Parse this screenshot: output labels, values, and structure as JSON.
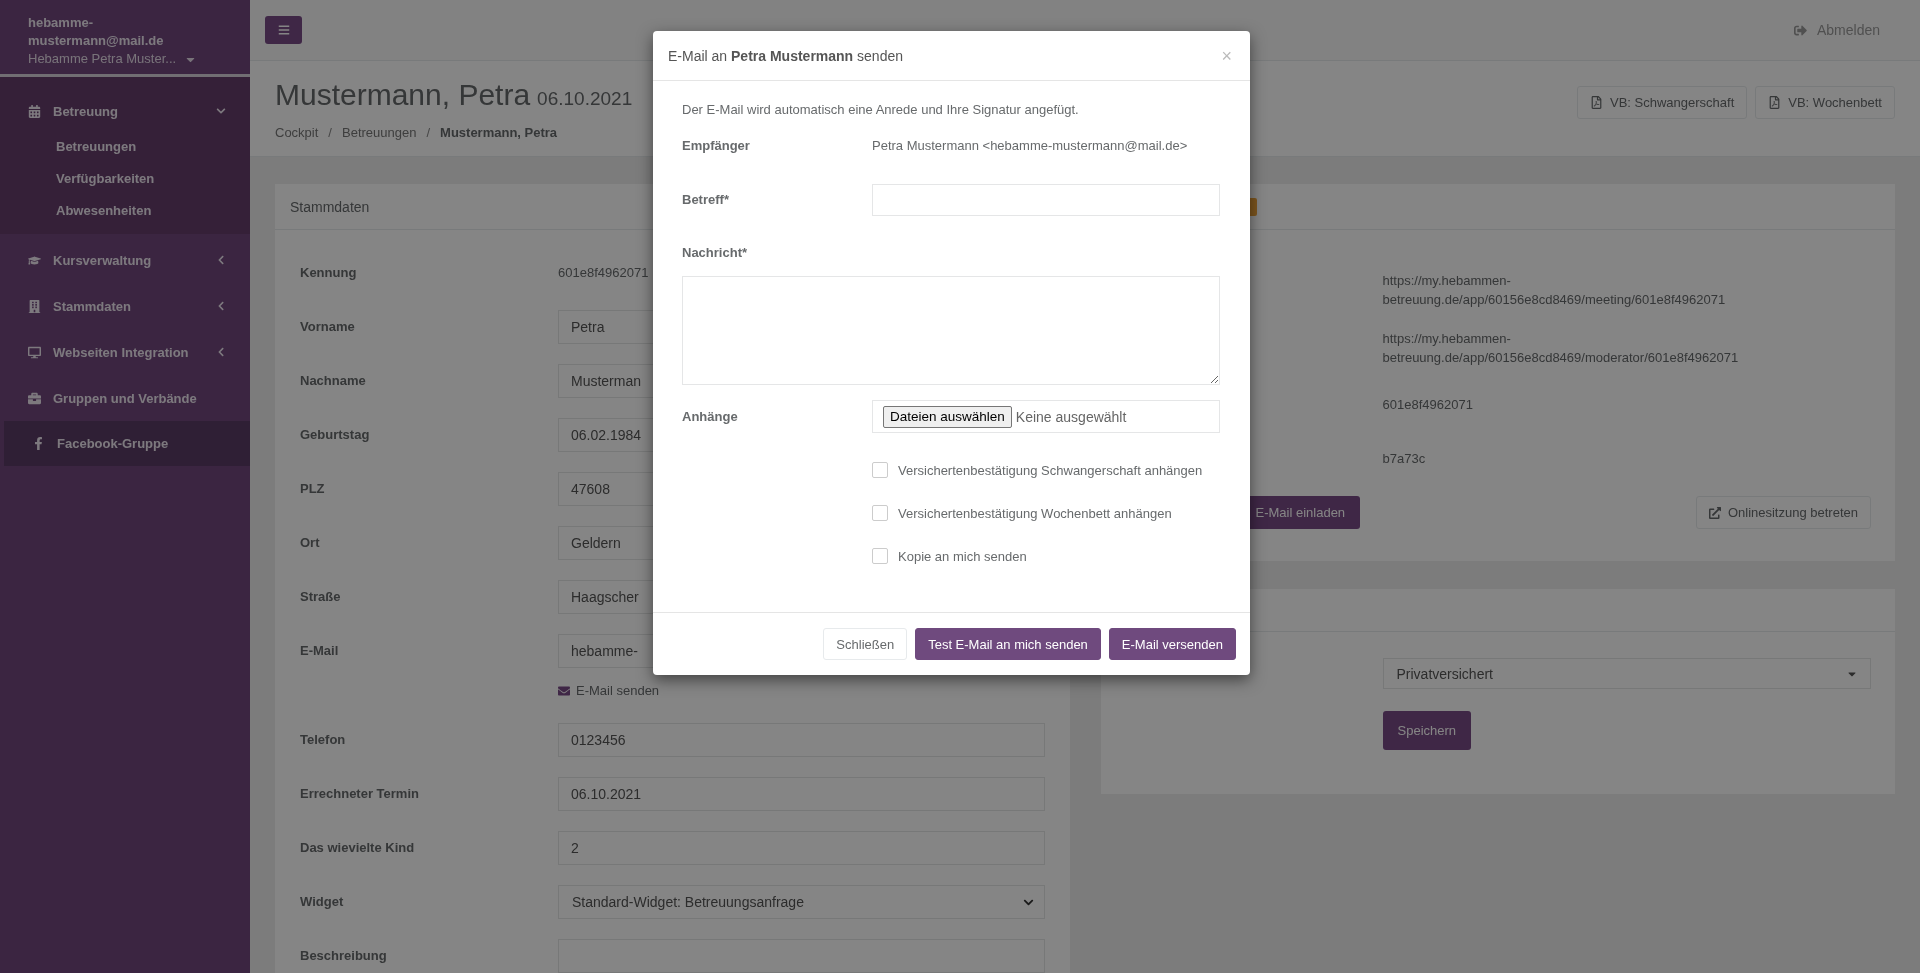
{
  "sidebar": {
    "user_email": "hebamme-mustermann@mail.de",
    "user_name": "Hebamme Petra Muster...",
    "items": [
      {
        "label": "Betreuung",
        "kind": "menu",
        "selected": false,
        "expanded": true,
        "children": [
          {
            "label": "Betreuungen"
          },
          {
            "label": "Verfügbarkeiten"
          },
          {
            "label": "Abwesenheiten"
          }
        ]
      },
      {
        "label": "Kursverwaltung",
        "kind": "menu",
        "selected": false,
        "expanded": false
      },
      {
        "label": "Stammdaten",
        "kind": "menu",
        "selected": false,
        "expanded": false
      },
      {
        "label": "Webseiten Integration",
        "kind": "menu",
        "selected": false,
        "expanded": false
      },
      {
        "label": "Gruppen und Verbände",
        "kind": "plain",
        "selected": false
      },
      {
        "label": "Facebook-Gruppe",
        "kind": "plain",
        "selected": true
      }
    ]
  },
  "topbar": {
    "logout": "Abmelden"
  },
  "page_header": {
    "title": "Mustermann, Petra",
    "date": "06.10.2021",
    "separator": "/",
    "breadcrumbs": [
      {
        "label": "Cockpit",
        "active": false
      },
      {
        "label": "Betreuungen",
        "active": false
      },
      {
        "label": "Mustermann, Petra",
        "active": true
      }
    ],
    "actions": [
      "VB: Schwangerschaft",
      "VB: Wochenbett"
    ]
  },
  "stammdaten": {
    "title": "Stammdaten",
    "fields": [
      {
        "label": "Kennung",
        "kind": "text",
        "value": "601e8f4962071"
      },
      {
        "label": "Vorname",
        "kind": "input",
        "value": "Petra"
      },
      {
        "label": "Nachname",
        "kind": "input",
        "value": "Musterman"
      },
      {
        "label": "Geburtstag",
        "kind": "input",
        "value": "06.02.1984"
      },
      {
        "label": "PLZ",
        "kind": "input",
        "value": "47608"
      },
      {
        "label": "Ort",
        "kind": "input",
        "value": "Geldern"
      },
      {
        "label": "Straße",
        "kind": "input",
        "value": "Haagscher"
      },
      {
        "label": "E-Mail",
        "kind": "input",
        "value": "hebamme-",
        "link": "E-Mail senden"
      },
      {
        "label": "Telefon",
        "kind": "input",
        "value": "0123456"
      },
      {
        "label": "Errechneter Termin",
        "kind": "input",
        "value": "06.10.2021"
      },
      {
        "label": "Das wievielte Kind",
        "kind": "input",
        "value": "2"
      },
      {
        "label": "Widget",
        "kind": "select",
        "value": "Standard-Widget: Betreuungsanfrage"
      },
      {
        "label": "Beschreibung",
        "kind": "input"
      }
    ]
  },
  "online_session": {
    "values": [
      "https://my.hebammen-betreuung.de/app/60156e8cd8469/meeting/601e8f4962071",
      "https://my.hebammen-betreuung.de/app/60156e8cd8469/moderator/601e8f4962071",
      "601e8f4962071",
      "b7a73c"
    ],
    "invite_button": "E-Mail einladen",
    "join_button": "Onlinesitzung betreten"
  },
  "insurance": {
    "value": "Privatversichert",
    "save": "Speichern"
  },
  "modal": {
    "title": "E-Mail an **Petra Mustermann** senden",
    "close": "×",
    "intro": "Der E-Mail wird automatisch eine Anrede und Ihre Signatur angefügt.",
    "recipient_label": "Empfänger",
    "recipient": "Petra Mustermann <hebamme-mustermann@mail.de>",
    "subject_label": "Betreff*",
    "message_label": "Nachricht*",
    "attachments_label": "Anhänge",
    "file_button": "Dateien auswählen",
    "file_status": "Keine ausgewählt",
    "checkboxes": [
      {
        "label": "Versichertenbestätigung Schwangerschaft anhängen",
        "checked": false
      },
      {
        "label": "Versichertenbestätigung Wochenbett anhängen",
        "checked": false
      },
      {
        "label": "Kopie an mich senden",
        "checked": false
      }
    ],
    "buttons": [
      {
        "label": "Schließen",
        "kind": "default"
      },
      {
        "label": "Test E-Mail an mich senden",
        "kind": "primary"
      },
      {
        "label": "E-Mail versenden",
        "kind": "primary"
      }
    ]
  }
}
